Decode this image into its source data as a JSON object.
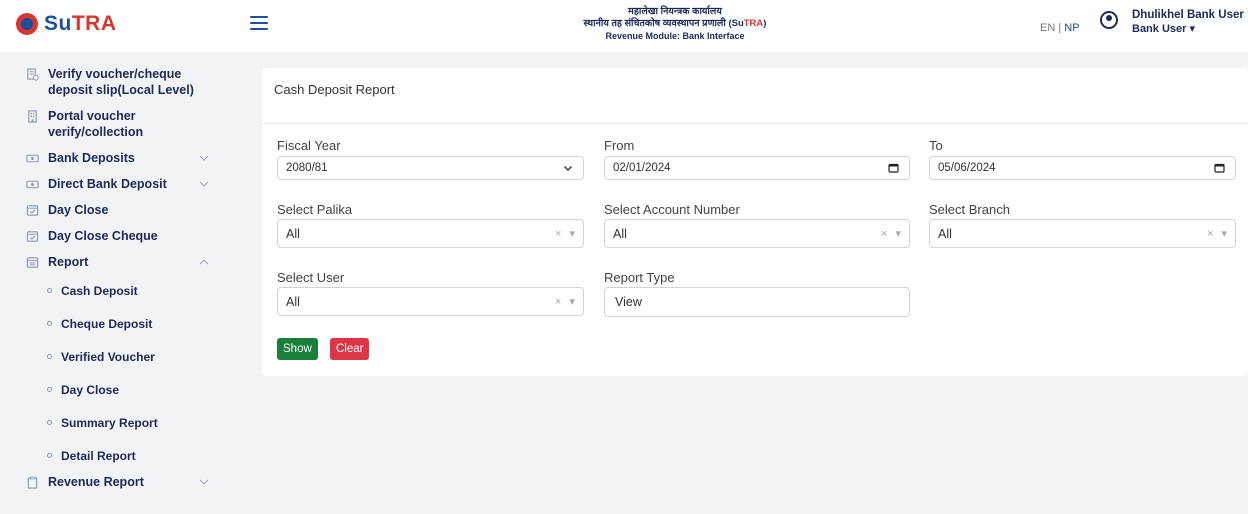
{
  "brand": {
    "name_su": "Su",
    "name_tra": "TRA",
    "brand_blue": "#1c4f9c",
    "brand_red": "#d6362d"
  },
  "header": {
    "line1": "महालेखा नियन्त्रक कार्यालय",
    "line2_prefix": "स्थानीय तह संचितकोष व्यवस्थापन प्रणाली (",
    "line2_su": "Su",
    "line2_tra": "TRA",
    "line2_suffix": ")",
    "line3": "Revenue Module: Bank Interface",
    "lang_en": "EN",
    "lang_sep": "|",
    "lang_np": "NP",
    "user_name": "Dhulikhel Bank User",
    "user_role": "Bank User ▾"
  },
  "sidebar": {
    "items": [
      {
        "label": "Verify voucher/cheque deposit slip(Local Level)",
        "icon": "voucher-verify-icon"
      },
      {
        "label": "Portal voucher verify/collection",
        "icon": "building-icon"
      },
      {
        "label": "Bank Deposits",
        "icon": "cash-icon",
        "chevron": "down"
      },
      {
        "label": "Direct Bank Deposit",
        "icon": "cash-icon",
        "chevron": "down"
      },
      {
        "label": "Day Close",
        "icon": "calendar-check-icon"
      },
      {
        "label": "Day Close Cheque",
        "icon": "calendar-check-icon"
      },
      {
        "label": "Report",
        "icon": "report-icon",
        "chevron": "up"
      }
    ],
    "report_subitems": [
      "Cash Deposit",
      "Cheque Deposit",
      "Verified Voucher",
      "Day Close",
      "Summary Report",
      "Detail Report"
    ],
    "revenue_report": {
      "label": "Revenue Report",
      "icon": "clipboard-icon",
      "chevron": "down"
    }
  },
  "card": {
    "title": "Cash Deposit Report",
    "fiscal_year": {
      "label": "Fiscal Year",
      "value": "2080/81"
    },
    "from": {
      "label": "From",
      "value": "02/01/2024"
    },
    "to": {
      "label": "To",
      "value": "05/06/2024"
    },
    "palika": {
      "label": "Select Palika",
      "value": "All"
    },
    "account": {
      "label": "Select Account Number",
      "value": "All"
    },
    "branch": {
      "label": "Select Branch",
      "value": "All"
    },
    "user": {
      "label": "Select User",
      "value": "All"
    },
    "report_type": {
      "label": "Report Type",
      "value": "View"
    },
    "show_label": "Show",
    "clear_label": "Clear"
  }
}
